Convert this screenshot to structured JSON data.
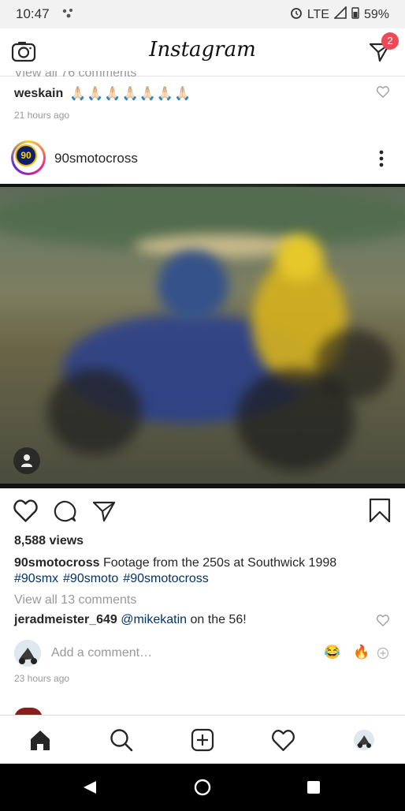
{
  "status_bar": {
    "time": "10:47",
    "network": "LTE",
    "battery": "59%",
    "icons": [
      "assistant-dots-icon",
      "alarm-icon",
      "signal-icon",
      "battery-icon"
    ]
  },
  "header": {
    "app_name": "Instagram",
    "direct_badge": "2",
    "icons": [
      "camera-icon",
      "direct-message-icon"
    ]
  },
  "previous_post": {
    "comments_link": "View all 76 comments",
    "username": "weskain",
    "comment": "🙏🏻🙏🏻🙏🏻🙏🏻🙏🏻🙏🏻🙏🏻",
    "time": "21 hours ago"
  },
  "post": {
    "username": "90smotocross",
    "avatar_text": "90",
    "views": "8,588 views",
    "caption_user": "90smotocross",
    "caption_text": "Footage from the 250s at Southwick 1998",
    "hashtags": [
      "#90smx",
      "#90smoto",
      "#90smotocross"
    ],
    "view_comments": "View all 13 comments",
    "comment": {
      "username": "jeradmeister_649",
      "mention": "@mikekatin",
      "text": "on the 56!"
    },
    "add_comment_placeholder": "Add a comment…",
    "quick_emojis": [
      "😂",
      "🔥"
    ],
    "time": "23 hours ago",
    "icons": [
      "more-options-icon",
      "like-icon",
      "comment-icon",
      "share-icon",
      "save-icon",
      "user-tag-icon",
      "add-emoji-icon"
    ]
  },
  "bottom_nav": [
    "home-icon",
    "search-icon",
    "create-post-icon",
    "activity-icon",
    "profile-icon"
  ],
  "android_nav": [
    "back-icon",
    "home-button-icon",
    "recents-icon"
  ],
  "colors": {
    "link": "#003569",
    "badge": "#ed4956",
    "muted": "#999999"
  }
}
